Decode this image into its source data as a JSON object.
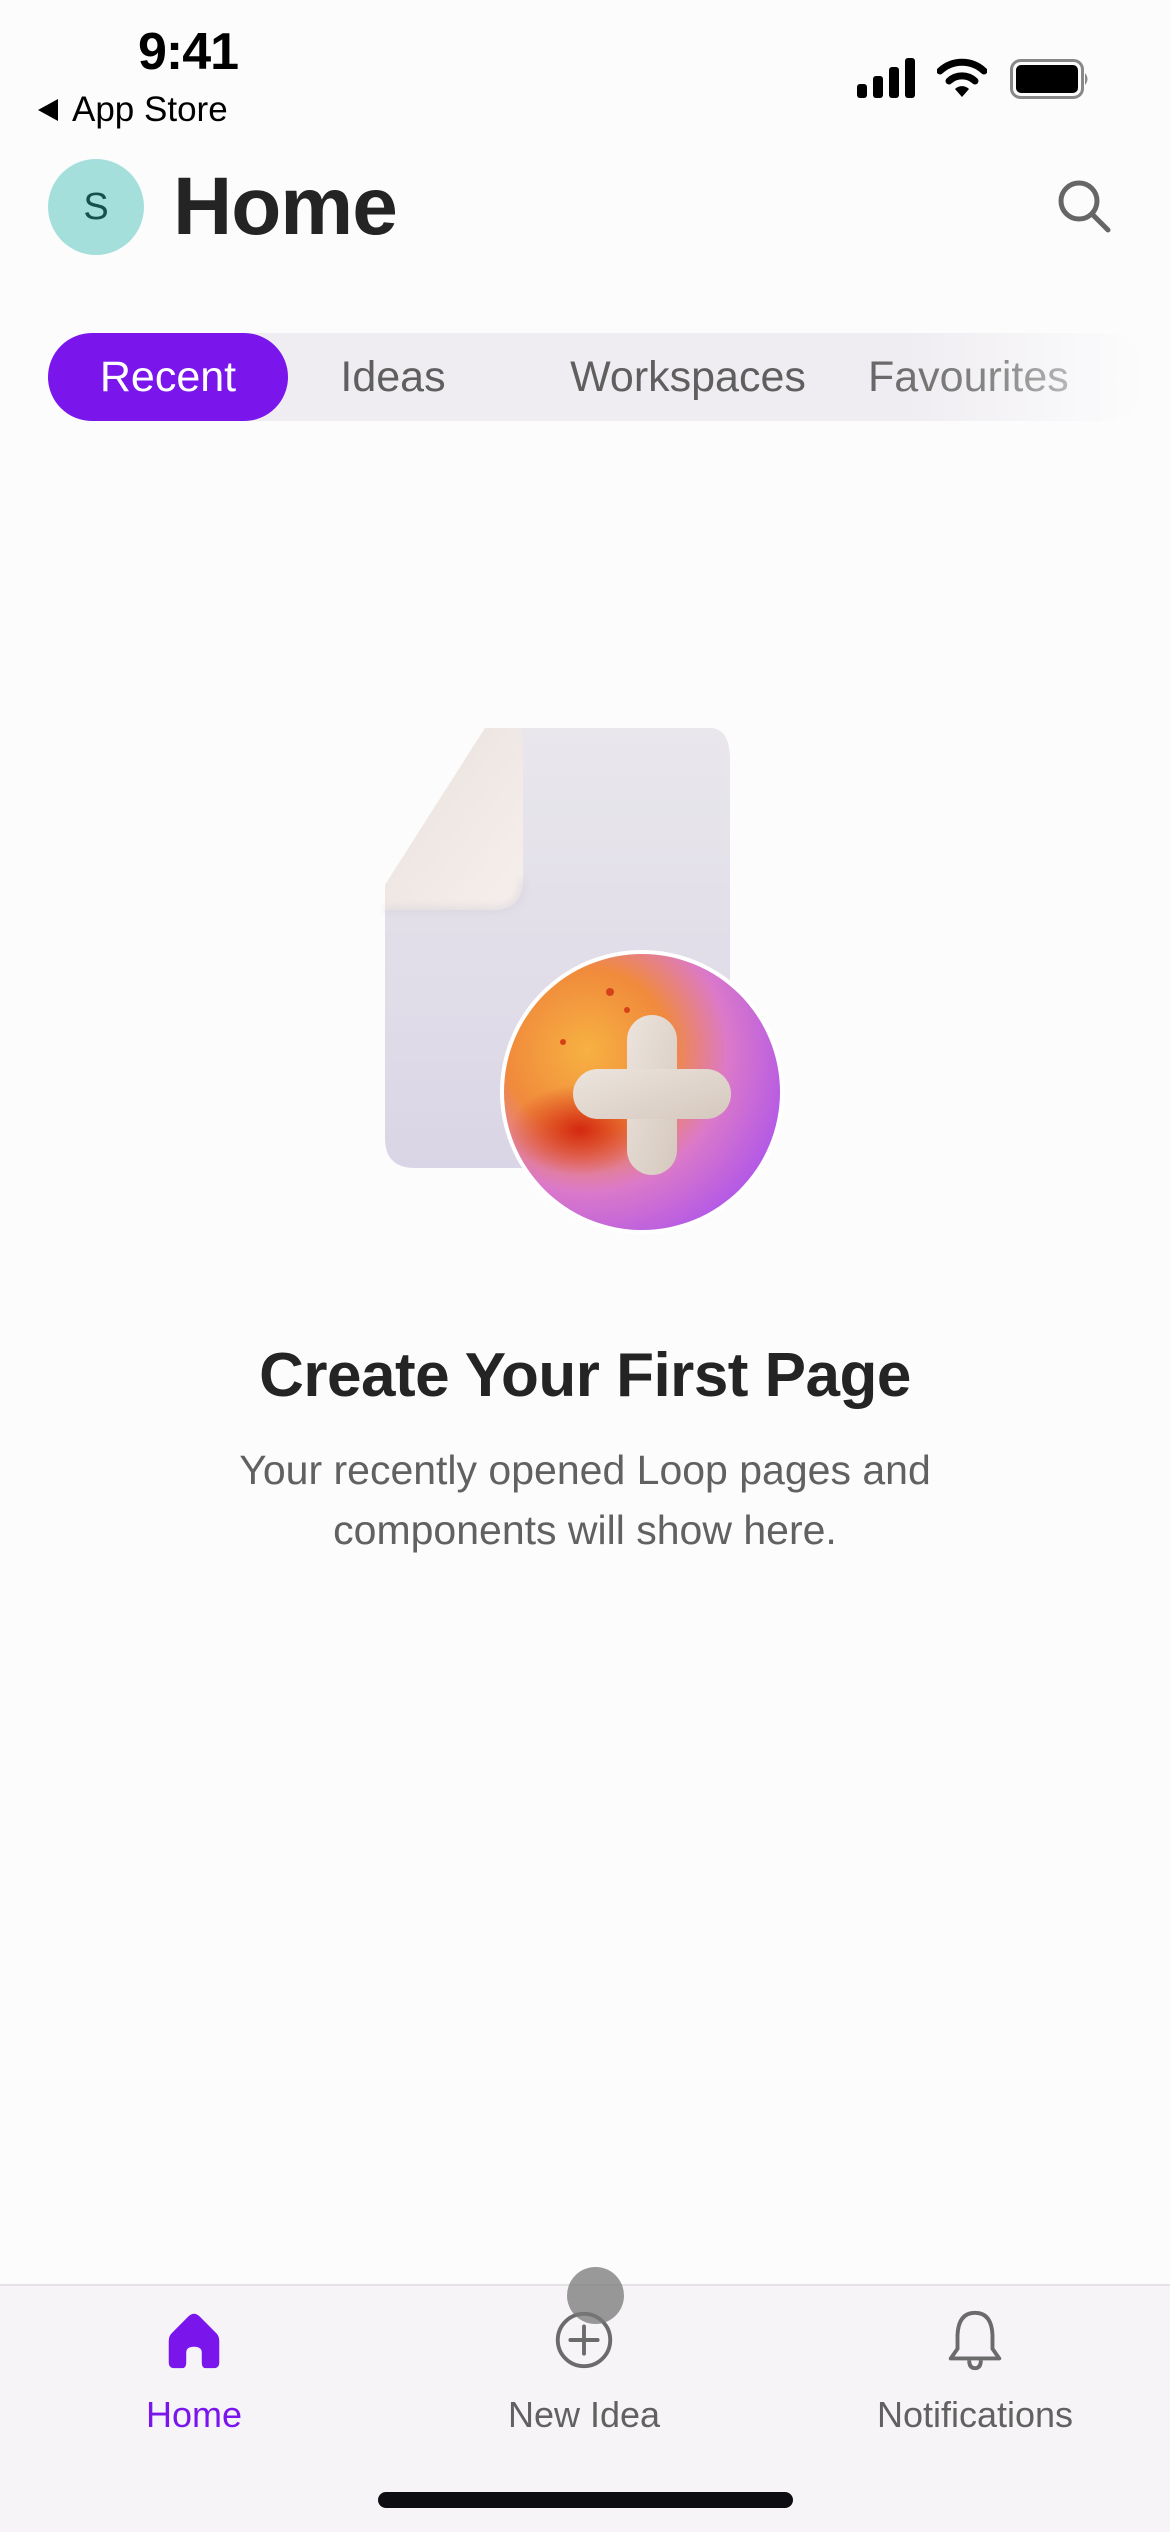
{
  "status_bar": {
    "time": "9:41",
    "back_label": "App Store",
    "icons": [
      "cellular-signal-icon",
      "wifi-icon",
      "battery-icon"
    ]
  },
  "header": {
    "avatar_initial": "S",
    "title": "Home",
    "search_icon": "search-icon"
  },
  "tabs": [
    {
      "label": "Recent",
      "active": true
    },
    {
      "label": "Ideas",
      "active": false
    },
    {
      "label": "Workspaces",
      "active": false
    },
    {
      "label": "Favourites",
      "active": false
    }
  ],
  "empty_state": {
    "illustration": "new-page-plus-illustration",
    "title": "Create Your First Page",
    "subtitle_line1": "Your recently opened Loop pages and",
    "subtitle_line2": "components will show here."
  },
  "bottom_nav": [
    {
      "label": "Home",
      "icon": "home-icon",
      "active": true
    },
    {
      "label": "New Idea",
      "icon": "plus-circle-icon",
      "active": false
    },
    {
      "label": "Notifications",
      "icon": "bell-icon",
      "active": false
    }
  ],
  "colors": {
    "accent": "#7A16EC",
    "avatar_bg": "#A4DFDB",
    "avatar_text": "#17514D",
    "tab_track": "#EFEDF1",
    "nav_bg": "#F6F4F7"
  }
}
